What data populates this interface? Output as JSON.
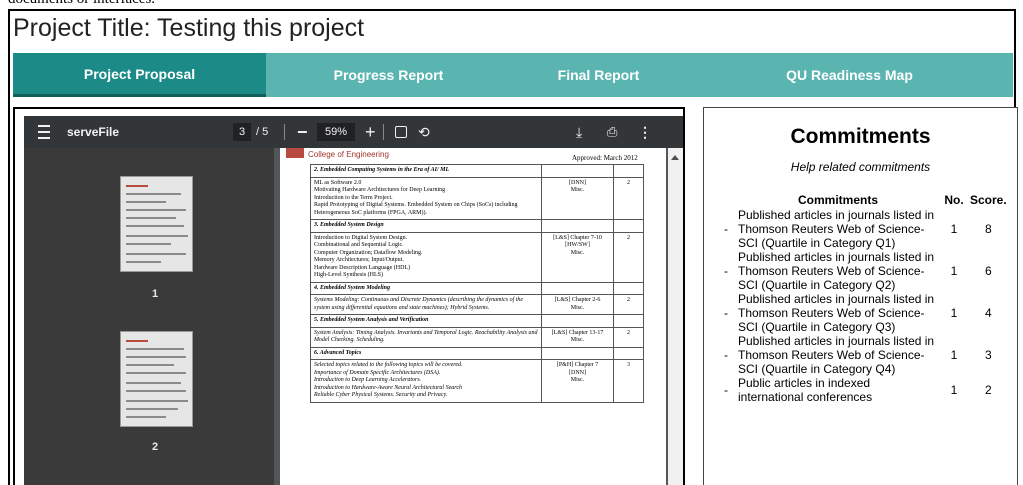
{
  "top_clip": "documents or interfaces.",
  "project_title": "Project Title: Testing this project",
  "tabs": [
    {
      "label": "Project Proposal",
      "active": true
    },
    {
      "label": "Progress Report"
    },
    {
      "label": "Final Report"
    },
    {
      "label": "QU Readiness Map"
    }
  ],
  "viewer": {
    "file_name": "serveFile",
    "page_current": "3",
    "page_sep": "/",
    "page_total": "5",
    "zoom": "59%",
    "thumb_labels": [
      "1",
      "2"
    ],
    "icons": [
      "menu-icon",
      "zoom-out-icon",
      "zoom-in-icon",
      "fit-page-icon",
      "rotate-icon",
      "download-icon",
      "print-icon",
      "more-icon"
    ]
  },
  "doc": {
    "college": "College of Engineering",
    "approved": "Approved: March 2012",
    "rows": [
      {
        "head": "2.  Embedded Computing Systems in the Era of AI/ ML",
        "body": "ML as Software 2.0\nMotivating Hardware Architectures for Deep Learning\nIntroduction to the Term Project.\nRapid Prototyping of Digital Systems. Embedded System on Chips (SoCs) including Heterogeneous SoC platforms (FPGA, ARM)).",
        "ref": "[DNN]\nMisc.",
        "n": "2"
      },
      {
        "head": "3.  Embedded System Design",
        "body": "Introduction to Digital System Design.\nCombinational and Sequential Logic.\nComputer Organization; Dataflow Modeling.\nMemory Architectures; Input/Output.\nHardware Description Language (HDL)\nHigh-Level Synthesis (HLS)",
        "ref": "[L&S] Chapter 7-10\n[HW/SW]\nMisc.",
        "n": "2"
      },
      {
        "head": "4.  Embedded System Modeling",
        "body": "Systems Modeling: Continuous and Discrete Dynamics (describing the dynamics of the system using differential equations and state machines); Hybrid Systems.",
        "ref": "[L&S] Chapter 2-6\nMisc.",
        "n": "2"
      },
      {
        "head": "5.  Embedded System Analysis and Verification",
        "body": "System Analysis: Timing Analysis. Invariants and Temporal Logic. Reachability Analysis and Model Checking. Scheduling.",
        "ref": "[L&S] Chapter 13-17\nMisc.",
        "n": "2"
      },
      {
        "head": "6.  Advanced Topics",
        "body": "Selected topics related to the following topics will be covered.\nImportance of Domain Specific Architectures (DSA).\nIntroduction to Deep Learning Accelerators.\nIntroduction to Hardware-Aware Neural Architectural Search\nReliable Cyber Physical Systems. Security and Privacy.",
        "ref": "[P&H] Chapter 7\n[DNN]\nMisc.",
        "n": "3"
      }
    ]
  },
  "commitments": {
    "title": "Commitments",
    "subtitle": "Help related commitments",
    "col_commitments": "Commitments",
    "col_no": "No.",
    "col_score": "Score.",
    "rows": [
      {
        "dash": "-",
        "text": "Published articles in journals listed in Thomson Reuters Web of Science-SCI (Quartile in Category Q1)",
        "no": "1",
        "score": "8"
      },
      {
        "dash": "-",
        "text": "Published articles in journals listed in Thomson Reuters Web of Science-SCI (Quartile in Category Q2)",
        "no": "1",
        "score": "6"
      },
      {
        "dash": "-",
        "text": "Published articles in journals listed in Thomson Reuters Web of Science-SCI (Quartile in Category Q3)",
        "no": "1",
        "score": "4"
      },
      {
        "dash": "-",
        "text": "Published articles in journals listed in Thomson Reuters Web of Science-SCI (Quartile in Category Q4)",
        "no": "1",
        "score": "3"
      },
      {
        "dash": "-",
        "text": "Public articles in indexed international conferences",
        "no": "1",
        "score": "2"
      }
    ]
  }
}
